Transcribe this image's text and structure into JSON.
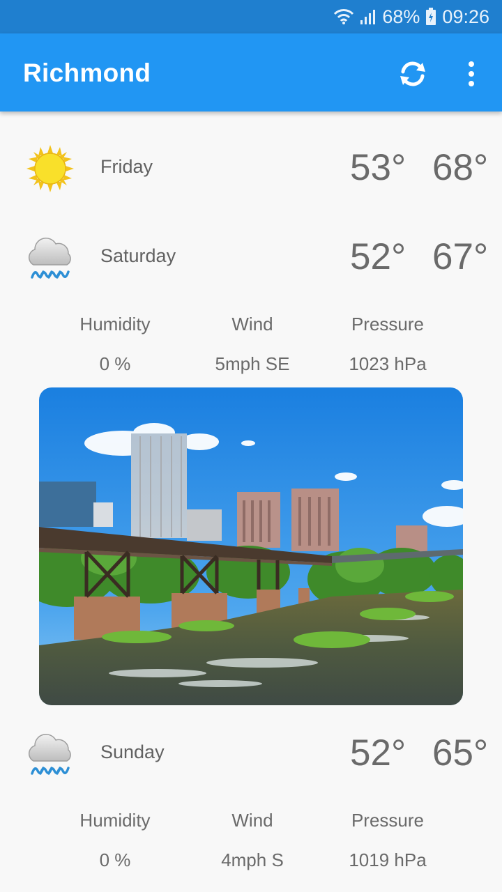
{
  "status_bar": {
    "battery": "68%",
    "time": "09:26",
    "icons": [
      "wifi-icon",
      "signal-icon",
      "battery-icon"
    ]
  },
  "app_bar": {
    "title": "Richmond",
    "icons": [
      "refresh-icon",
      "more-vert-icon"
    ]
  },
  "colors": {
    "app_bar": "#2196f3",
    "status_bar": "#1f7fcf",
    "text": "#616161",
    "sun": "#f7d51d",
    "rain": "#2d8fd5"
  },
  "forecast": [
    {
      "day": "Friday",
      "icon": "sun-icon",
      "low": "53°",
      "high": "68°"
    },
    {
      "day": "Saturday",
      "icon": "rain-cloud-icon",
      "low": "52°",
      "high": "67°",
      "details": {
        "humidity_label": "Humidity",
        "humidity": "0 %",
        "wind_label": "Wind",
        "wind": "5mph SE",
        "pressure_label": "Pressure",
        "pressure": "1023 hPa"
      }
    },
    {
      "day": "Sunday",
      "icon": "rain-cloud-icon",
      "low": "52°",
      "high": "65°",
      "details": {
        "humidity_label": "Humidity",
        "humidity": "0 %",
        "wind_label": "Wind",
        "wind": "4mph S",
        "pressure_label": "Pressure",
        "pressure": "1019 hPa"
      }
    }
  ],
  "photo": {
    "subject": "city-skyline-river-photo"
  }
}
